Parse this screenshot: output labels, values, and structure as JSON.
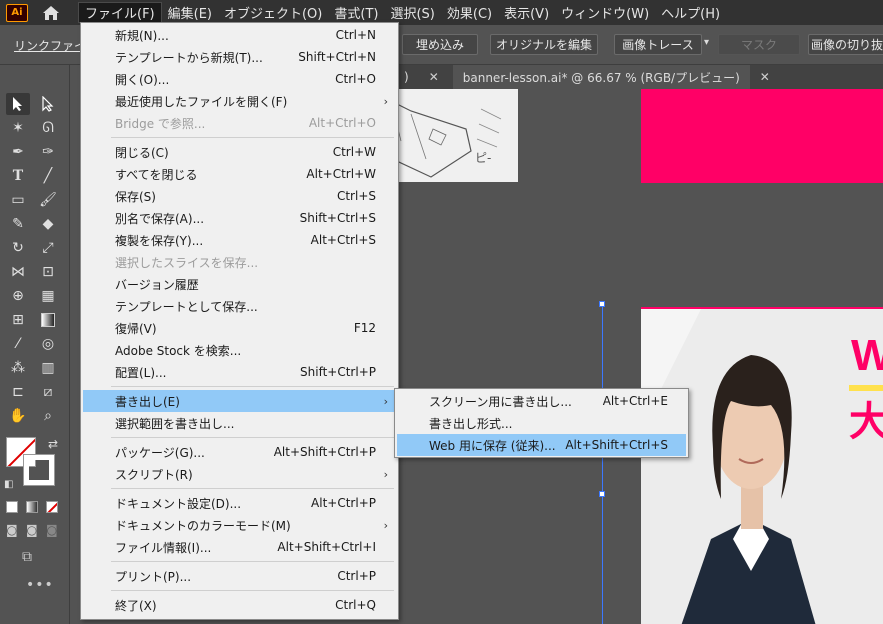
{
  "menubar": {
    "logo": "Ai",
    "items": [
      "ファイル(F)",
      "編集(E)",
      "オブジェクト(O)",
      "書式(T)",
      "選択(S)",
      "効果(C)",
      "表示(V)",
      "ウィンドウ(W)",
      "ヘルプ(H)"
    ]
  },
  "controlbar": {
    "link_label": "リンクファイル",
    "embed": "埋め込み",
    "edit_original": "オリジナルを編集",
    "image_trace": "画像トレース",
    "mask": "マスク",
    "crop": "画像の切り抜き"
  },
  "tabs": {
    "active": "banner-lesson.ai* @ 66.67 % (RGB/プレビュー)"
  },
  "canvas": {
    "banner_w": "W",
    "banner_kanji": "大",
    "sketch_text": "ピ-"
  },
  "file_menu": {
    "new": {
      "label": "新規(N)...",
      "shortcut": "Ctrl+N"
    },
    "new_template": {
      "label": "テンプレートから新規(T)...",
      "shortcut": "Shift+Ctrl+N"
    },
    "open": {
      "label": "開く(O)...",
      "shortcut": "Ctrl+O"
    },
    "open_recent": {
      "label": "最近使用したファイルを開く(F)"
    },
    "bridge": {
      "label": "Bridge で参照...",
      "shortcut": "Alt+Ctrl+O"
    },
    "close": {
      "label": "閉じる(C)",
      "shortcut": "Ctrl+W"
    },
    "close_all": {
      "label": "すべてを閉じる",
      "shortcut": "Alt+Ctrl+W"
    },
    "save": {
      "label": "保存(S)",
      "shortcut": "Ctrl+S"
    },
    "save_as": {
      "label": "別名で保存(A)...",
      "shortcut": "Shift+Ctrl+S"
    },
    "save_copy": {
      "label": "複製を保存(Y)...",
      "shortcut": "Alt+Ctrl+S"
    },
    "save_slices": {
      "label": "選択したスライスを保存..."
    },
    "version_history": {
      "label": "バージョン履歴"
    },
    "save_template": {
      "label": "テンプレートとして保存..."
    },
    "revert": {
      "label": "復帰(V)",
      "shortcut": "F12"
    },
    "adobe_stock": {
      "label": "Adobe Stock を検索..."
    },
    "place": {
      "label": "配置(L)...",
      "shortcut": "Shift+Ctrl+P"
    },
    "export": {
      "label": "書き出し(E)"
    },
    "export_selection": {
      "label": "選択範囲を書き出し..."
    },
    "package": {
      "label": "パッケージ(G)...",
      "shortcut": "Alt+Shift+Ctrl+P"
    },
    "scripts": {
      "label": "スクリプト(R)"
    },
    "doc_setup": {
      "label": "ドキュメント設定(D)...",
      "shortcut": "Alt+Ctrl+P"
    },
    "doc_color_mode": {
      "label": "ドキュメントのカラーモード(M)"
    },
    "file_info": {
      "label": "ファイル情報(I)...",
      "shortcut": "Alt+Shift+Ctrl+I"
    },
    "print": {
      "label": "プリント(P)...",
      "shortcut": "Ctrl+P"
    },
    "quit": {
      "label": "終了(X)",
      "shortcut": "Ctrl+Q"
    }
  },
  "export_menu": {
    "for_screens": {
      "label": "スクリーン用に書き出し...",
      "shortcut": "Alt+Ctrl+E"
    },
    "export_as": {
      "label": "書き出し形式..."
    },
    "save_for_web": {
      "label": "Web 用に保存 (従来)...",
      "shortcut": "Alt+Shift+Ctrl+S"
    }
  },
  "colors": {
    "accent_pink": "#ff0066",
    "menu_highlight": "#91c9f7",
    "selection_blue": "#3c78ff"
  }
}
